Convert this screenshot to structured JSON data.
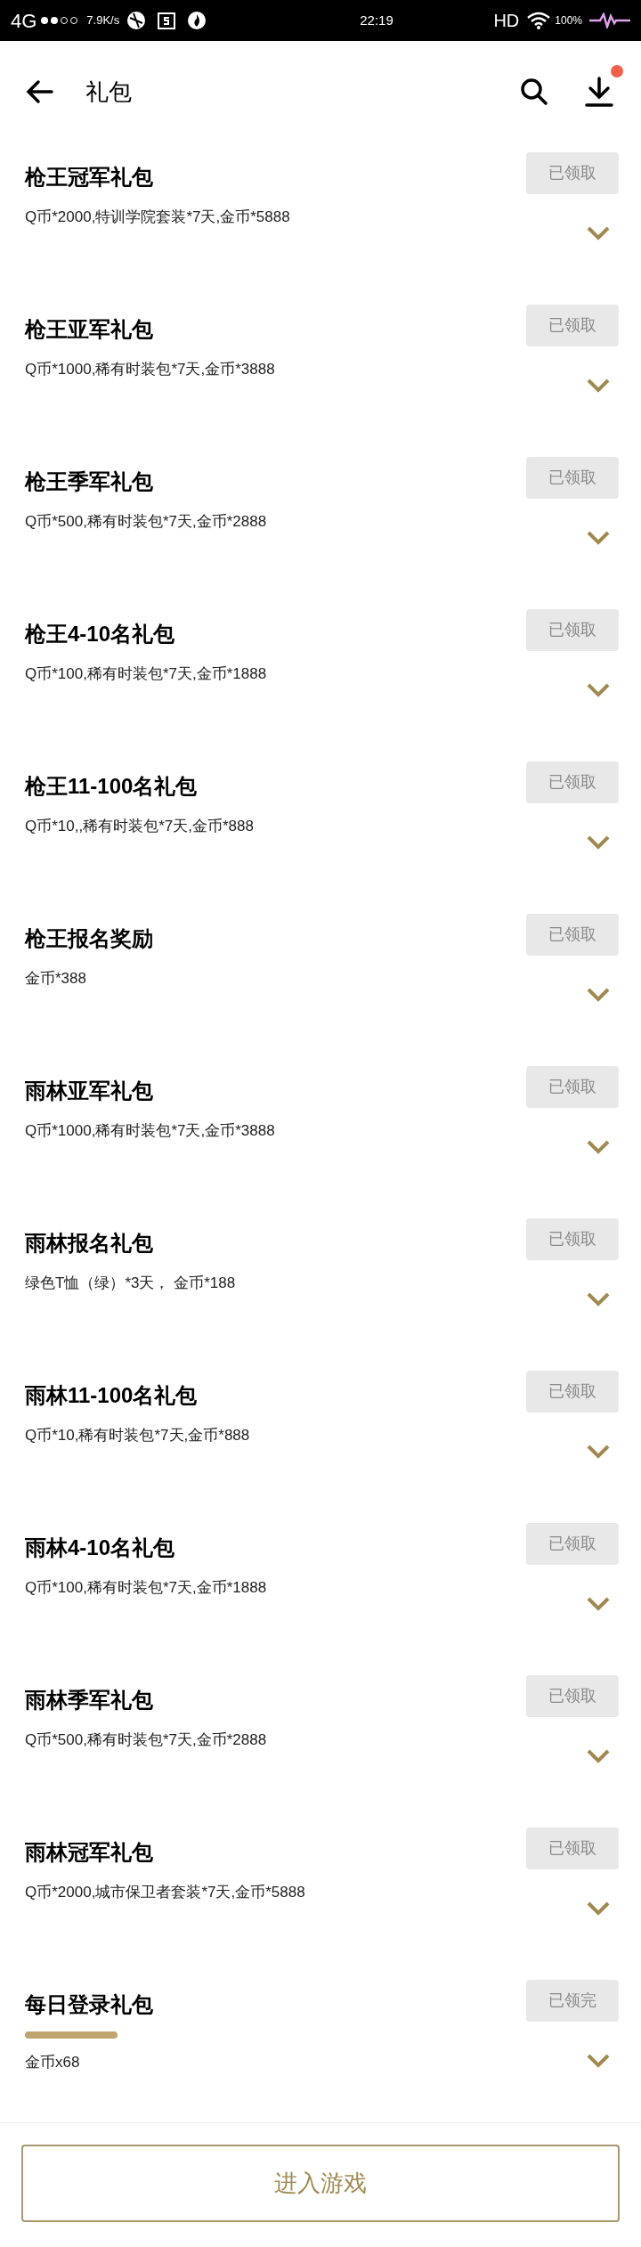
{
  "status_bar": {
    "network": "4G",
    "speed": "7.9K/s",
    "time": "22:19",
    "hd": "HD",
    "battery": "100%"
  },
  "header": {
    "title": "礼包",
    "download_badge": true
  },
  "gifts": [
    {
      "title": "枪王冠军礼包",
      "desc": "Q币*2000,特训学院套装*7天,金币*5888",
      "button": "已领取",
      "disabled": true
    },
    {
      "title": "枪王亚军礼包",
      "desc": "Q币*1000,稀有时装包*7天,金币*3888",
      "button": "已领取",
      "disabled": true
    },
    {
      "title": "枪王季军礼包",
      "desc": "Q币*500,稀有时装包*7天,金币*2888",
      "button": "已领取",
      "disabled": true
    },
    {
      "title": "枪王4-10名礼包",
      "desc": "Q币*100,稀有时装包*7天,金币*1888",
      "button": "已领取",
      "disabled": true
    },
    {
      "title": "枪王11-100名礼包",
      "desc": "Q币*10,,稀有时装包*7天,金币*888",
      "button": "已领取",
      "disabled": true
    },
    {
      "title": "枪王报名奖励",
      "desc": "金币*388",
      "button": "已领取",
      "disabled": true
    },
    {
      "title": "雨林亚军礼包",
      "desc": "Q币*1000,稀有时装包*7天,金币*3888",
      "button": "已领取",
      "disabled": true
    },
    {
      "title": "雨林报名礼包",
      "desc": "绿色T恤（绿）*3天， 金币*188",
      "button": "已领取",
      "disabled": true
    },
    {
      "title": "雨林11-100名礼包",
      "desc": "Q币*10,稀有时装包*7天,金币*888",
      "button": "已领取",
      "disabled": true
    },
    {
      "title": "雨林4-10名礼包",
      "desc": "Q币*100,稀有时装包*7天,金币*1888",
      "button": "已领取",
      "disabled": true
    },
    {
      "title": "雨林季军礼包",
      "desc": "Q币*500,稀有时装包*7天,金币*2888",
      "button": "已领取",
      "disabled": true
    },
    {
      "title": "雨林冠军礼包",
      "desc": "Q币*2000,城市保卫者套装*7天,金币*5888",
      "button": "已领取",
      "disabled": true
    },
    {
      "title": "每日登录礼包",
      "desc": "金币x68",
      "button": "已领完",
      "disabled": true,
      "highlighted": true
    }
  ],
  "enter_button": "进入游戏"
}
